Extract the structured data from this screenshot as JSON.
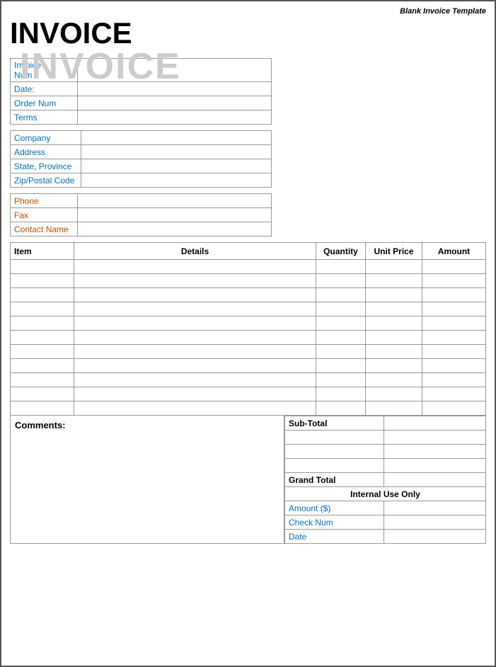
{
  "page": {
    "template_label": "Blank Invoice Template",
    "watermark": "INVOICE",
    "title": "INVOICE"
  },
  "info_section1": {
    "rows": [
      {
        "label": "Invoice\nNum",
        "value": ""
      },
      {
        "label": "Date:",
        "value": ""
      },
      {
        "label": "Order Num",
        "value": ""
      },
      {
        "label": "Terms",
        "value": ""
      }
    ]
  },
  "info_section2": {
    "rows": [
      {
        "label": "Company",
        "value": ""
      },
      {
        "label": "Address",
        "value": ""
      },
      {
        "label": "State, Province",
        "value": ""
      },
      {
        "label": "Zip/Postal Code",
        "value": ""
      }
    ]
  },
  "info_section3": {
    "rows": [
      {
        "label": "Phone",
        "value": "",
        "type": "orange"
      },
      {
        "label": "Fax",
        "value": "",
        "type": "orange"
      },
      {
        "label": "Contact Name",
        "value": "",
        "type": "orange"
      }
    ]
  },
  "items_table": {
    "headers": [
      "Item",
      "Details",
      "Quantity",
      "Unit Price",
      "Amount"
    ],
    "rows": 11
  },
  "bottom": {
    "comments_label": "Comments:",
    "subtotal_label": "Sub-Total",
    "grand_total_label": "Grand Total",
    "internal_use_label": "Internal Use Only",
    "internal_rows": [
      {
        "label": "Amount ($)",
        "value": ""
      },
      {
        "label": "Check Num",
        "value": ""
      },
      {
        "label": "Date",
        "value": ""
      }
    ],
    "blank_rows": 3
  }
}
